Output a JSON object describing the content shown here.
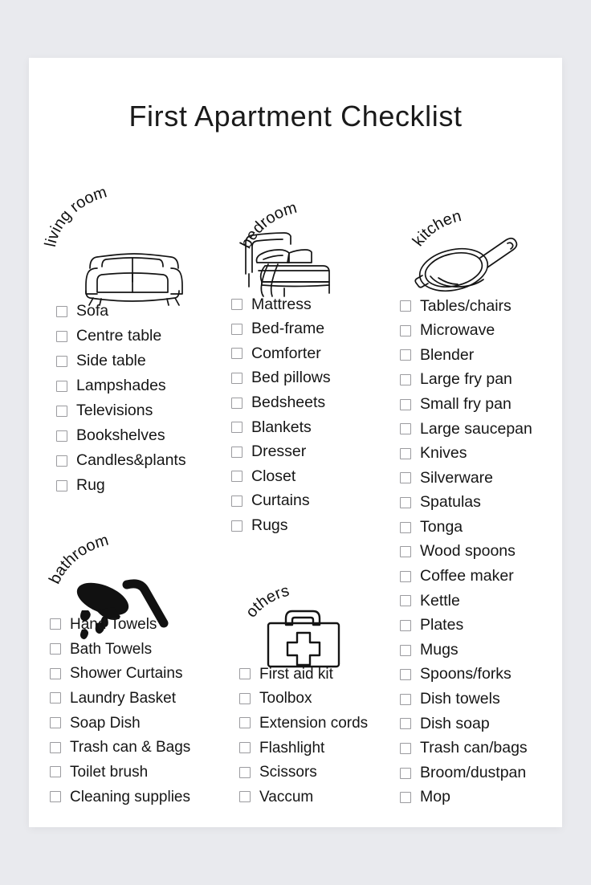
{
  "page": {
    "title": "First Apartment Checklist",
    "background_color": "#e9eaee",
    "sheet_color": "#ffffff",
    "text_color": "#161616",
    "checkbox_border_color": "#9b9b9f"
  },
  "sections": {
    "living_room": {
      "label": "living room",
      "icon": "sofa-icon",
      "items": [
        "Sofa",
        "Centre table",
        "Side table",
        "Lampshades",
        "Televisions",
        "Bookshelves",
        "Candles&plants",
        "Rug"
      ]
    },
    "bedroom": {
      "label": "bedroom",
      "icon": "bed-icon",
      "items": [
        "Mattress",
        "Bed-frame",
        "Comforter",
        "Bed pillows",
        "Bedsheets",
        "Blankets",
        "Dresser",
        "Closet",
        "Curtains",
        "Rugs"
      ]
    },
    "kitchen": {
      "label": "kitchen",
      "icon": "frying-pan-icon",
      "items": [
        "Tables/chairs",
        "Microwave",
        "Blender",
        "Large fry pan",
        "Small fry pan",
        "Large saucepan",
        "Knives",
        "Silverware",
        "Spatulas",
        "Tonga",
        "Wood spoons",
        "Coffee maker",
        "Kettle",
        "Plates",
        "Mugs",
        "Spoons/forks",
        "Dish towels",
        "Dish soap",
        "Trash can/bags",
        "Broom/dustpan",
        "Mop"
      ]
    },
    "bathroom": {
      "label": "bathroom",
      "icon": "shower-head-icon",
      "items": [
        "Hand Towels",
        "Bath Towels",
        "Shower Curtains",
        "Laundry Basket",
        "Soap Dish",
        "Trash can & Bags",
        "Toilet brush",
        "Cleaning supplies"
      ]
    },
    "others": {
      "label": "others",
      "icon": "first-aid-kit-icon",
      "items": [
        "First aid kit",
        "Toolbox",
        "Extension cords",
        "Flashlight",
        "Scissors",
        "Vaccum"
      ]
    }
  }
}
